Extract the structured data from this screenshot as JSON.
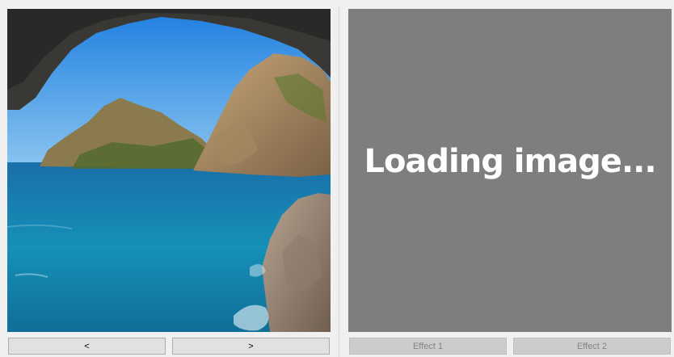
{
  "preview": {
    "status_text": "Loading image..."
  },
  "navigation": {
    "prev_label": "<",
    "next_label": ">"
  },
  "effects": {
    "effect1_label": "Effect 1",
    "effect2_label": "Effect 2"
  },
  "colors": {
    "window_bg": "#f0f0f0",
    "preview_bg": "#7e7e7e",
    "sea": "#1a86b3",
    "sky": "#2e8fe0"
  }
}
